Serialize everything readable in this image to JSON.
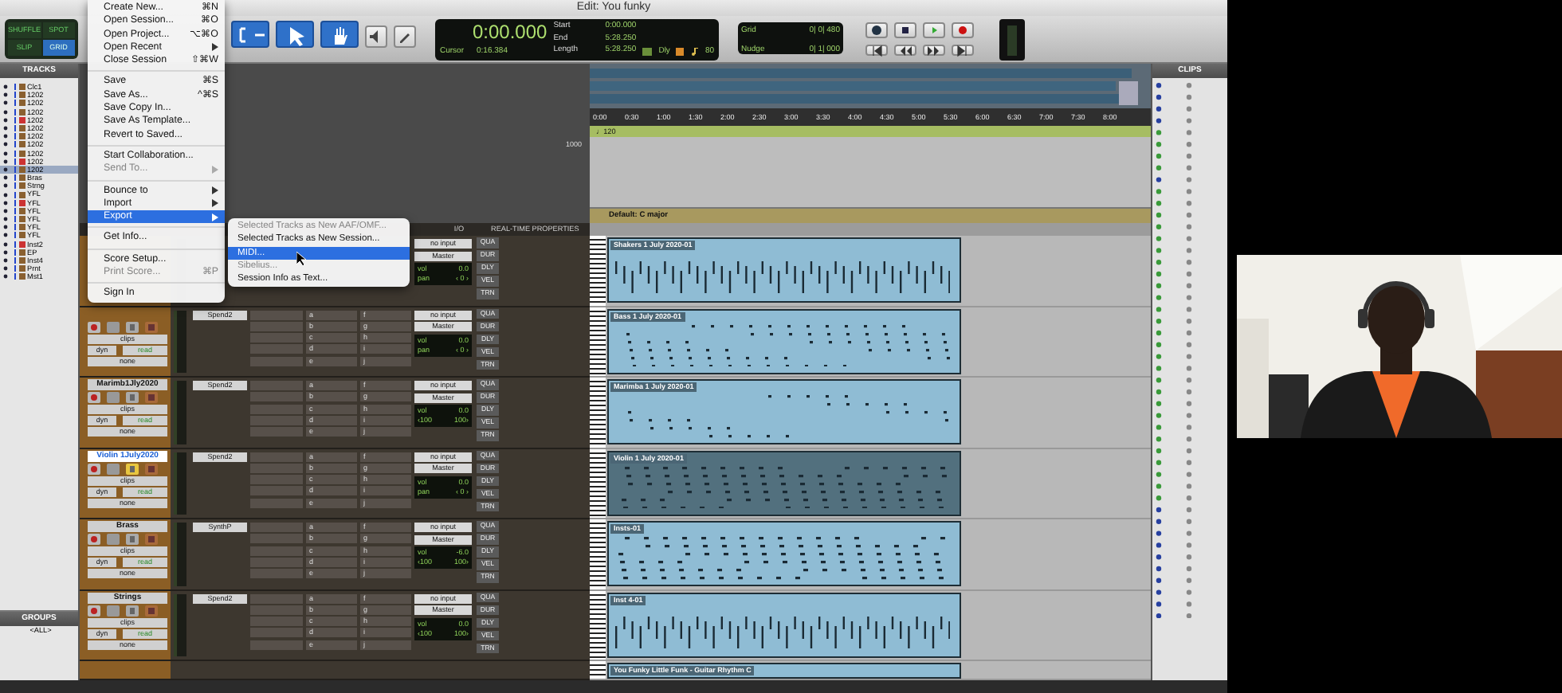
{
  "window": {
    "title": "Edit: You funky"
  },
  "modes": [
    {
      "label": "SHUFFLE",
      "selected": false
    },
    {
      "label": "SPOT",
      "selected": false
    },
    {
      "label": "SLIP",
      "selected": false
    },
    {
      "label": "GRID",
      "selected": true
    }
  ],
  "counter": {
    "main": "0:00.000",
    "start_label": "Start",
    "start": "0:00.000",
    "end_label": "End",
    "end": "5:28.250",
    "length_label": "Length",
    "length": "5:28.250",
    "cursor_label": "Cursor",
    "cursor": "0:16.384",
    "delay": "Dly",
    "value": "80"
  },
  "grid": {
    "label": "Grid",
    "value": "0| 0| 480"
  },
  "nudge": {
    "label": "Nudge",
    "value": "0| 1| 000"
  },
  "tracks_panel": {
    "title": "TRACKS",
    "items": [
      {
        "name": "Clc1",
        "selected": false
      },
      {
        "name": "1202",
        "selected": false
      },
      {
        "name": "1202",
        "selected": false
      },
      {
        "name": "1202",
        "selected": false
      },
      {
        "name": "1202",
        "selected": false
      },
      {
        "name": "1202",
        "selected": false
      },
      {
        "name": "1202",
        "selected": false
      },
      {
        "name": "1202",
        "selected": false
      },
      {
        "name": "1202",
        "selected": false
      },
      {
        "name": "1202",
        "selected": false
      },
      {
        "name": "1202",
        "selected": true
      },
      {
        "name": "Bras",
        "selected": false
      },
      {
        "name": "Strng",
        "selected": false
      },
      {
        "name": "YFL",
        "selected": false
      },
      {
        "name": "YFL",
        "selected": false
      },
      {
        "name": "YFL",
        "selected": false
      },
      {
        "name": "YFL",
        "selected": false
      },
      {
        "name": "YFL",
        "selected": false
      },
      {
        "name": "YFL",
        "selected": false
      },
      {
        "name": "Inst2",
        "selected": false
      },
      {
        "name": "EP",
        "selected": false
      },
      {
        "name": "Inst4",
        "selected": false
      },
      {
        "name": "Prnt",
        "selected": false
      },
      {
        "name": "Mst1",
        "selected": false
      }
    ]
  },
  "groups_panel": {
    "title": "GROUPS",
    "items": [
      "<ALL>"
    ]
  },
  "file_menu": {
    "items": [
      {
        "kind": "item",
        "label": "Create New...",
        "shortcut": "⌘N",
        "disabled": false,
        "submenu": false,
        "selected": false
      },
      {
        "kind": "item",
        "label": "Open Session...",
        "shortcut": "⌘O",
        "disabled": false,
        "submenu": false,
        "selected": false
      },
      {
        "kind": "item",
        "label": "Open Project...",
        "shortcut": "⌥⌘O",
        "disabled": false,
        "submenu": false,
        "selected": false
      },
      {
        "kind": "item",
        "label": "Open Recent",
        "disabled": false,
        "submenu": true,
        "selected": false
      },
      {
        "kind": "item",
        "label": "Close Session",
        "shortcut": "⇧⌘W",
        "disabled": false,
        "submenu": false,
        "selected": false
      },
      {
        "kind": "separator"
      },
      {
        "kind": "item",
        "label": "Save",
        "shortcut": "⌘S",
        "disabled": false,
        "submenu": false,
        "selected": false
      },
      {
        "kind": "item",
        "label": "Save As...",
        "shortcut": "^⌘S",
        "disabled": false,
        "submenu": false,
        "selected": false
      },
      {
        "kind": "item",
        "label": "Save Copy In...",
        "disabled": false,
        "submenu": false,
        "selected": false
      },
      {
        "kind": "item",
        "label": "Save As Template...",
        "disabled": false,
        "submenu": false,
        "selected": false
      },
      {
        "kind": "item",
        "label": "Revert to Saved...",
        "disabled": false,
        "submenu": false,
        "selected": false
      },
      {
        "kind": "separator"
      },
      {
        "kind": "item",
        "label": "Start Collaboration...",
        "disabled": false,
        "submenu": false,
        "selected": false
      },
      {
        "kind": "item",
        "label": "Send To...",
        "disabled": true,
        "submenu": true,
        "selected": false
      },
      {
        "kind": "separator"
      },
      {
        "kind": "item",
        "label": "Bounce to",
        "disabled": false,
        "submenu": true,
        "selected": false
      },
      {
        "kind": "item",
        "label": "Import",
        "disabled": false,
        "submenu": true,
        "selected": false
      },
      {
        "kind": "item",
        "label": "Export",
        "disabled": false,
        "submenu": true,
        "selected": true
      },
      {
        "kind": "separator"
      },
      {
        "kind": "item",
        "label": "Get Info...",
        "disabled": false,
        "submenu": false,
        "selected": false
      },
      {
        "kind": "separator"
      },
      {
        "kind": "item",
        "label": "Score Setup...",
        "disabled": false,
        "submenu": false,
        "selected": false
      },
      {
        "kind": "item",
        "label": "Print Score...",
        "shortcut": "⌘P",
        "disabled": true,
        "submenu": false,
        "selected": false
      },
      {
        "kind": "separator"
      },
      {
        "kind": "item",
        "label": "Sign In",
        "disabled": false,
        "submenu": false,
        "selected": false
      }
    ]
  },
  "export_submenu": {
    "items": [
      {
        "label": "Selected Tracks as New AAF/OMF...",
        "disabled": true,
        "selected": false
      },
      {
        "label": "Selected Tracks as New Session...",
        "disabled": false,
        "selected": false
      },
      {
        "label": "MIDI...",
        "disabled": false,
        "selected": true
      },
      {
        "label": "Sibelius...",
        "disabled": true,
        "selected": false
      },
      {
        "label": "Session Info as Text...",
        "disabled": false,
        "selected": false
      }
    ]
  },
  "conductor": {
    "scale": "1000",
    "tempo": "♩120",
    "key": "Default: C major"
  },
  "ruler": [
    "0:00",
    "0:30",
    "1:00",
    "1:30",
    "2:00",
    "2:30",
    "3:00",
    "3:30",
    "4:00",
    "4:30",
    "5:00",
    "5:30",
    "6:00",
    "6:30",
    "7:00",
    "7:30",
    "8:00"
  ],
  "mix": {
    "io_header": "I/O",
    "rtp_header": "REAL-TIME PROPERTIES",
    "strips": [
      {
        "input": "no input",
        "output": "Master",
        "vol_label": "vol",
        "vol": "0.0",
        "pan": [
          "pan",
          "‹ 0 ›"
        ],
        "rtp": [
          "QUA",
          "DUR",
          "DLY",
          "VEL",
          "TRN"
        ]
      },
      {
        "solo": false,
        "view": "clips",
        "dyn": "dyn",
        "automation": "read",
        "group": "none",
        "insert": "Spend2",
        "sends": [
          "a",
          "b",
          "c",
          "d",
          "e",
          "f",
          "g",
          "h",
          "i",
          "j"
        ],
        "input": "no input",
        "output": "Master",
        "vol_label": "vol",
        "vol": "0.0",
        "pan": [
          "pan",
          "‹ 0 ›"
        ],
        "rtp": [
          "QUA",
          "DUR",
          "DLY",
          "VEL",
          "TRN"
        ]
      },
      {
        "name": "Marimb1Jly2020",
        "selected": false,
        "solo": false,
        "view": "clips",
        "dyn": "dyn",
        "automation": "read",
        "group": "none",
        "insert": "Spend2",
        "sends": [
          "a",
          "b",
          "c",
          "d",
          "e",
          "f",
          "g",
          "h",
          "i",
          "j"
        ],
        "input": "no input",
        "output": "Master",
        "vol_label": "vol",
        "vol": "0.0",
        "pan": [
          "‹100",
          "100›"
        ],
        "rtp": [
          "QUA",
          "DUR",
          "DLY",
          "VEL",
          "TRN"
        ]
      },
      {
        "name": "Violin 1July2020",
        "selected": true,
        "solo": true,
        "view": "clips",
        "dyn": "dyn",
        "automation": "read",
        "group": "none",
        "insert": "Spend2",
        "sends": [
          "a",
          "b",
          "c",
          "d",
          "e",
          "f",
          "g",
          "h",
          "i",
          "j"
        ],
        "input": "no input",
        "output": "Master",
        "vol_label": "vol",
        "vol": "0.0",
        "pan": [
          "pan",
          "‹ 0 ›"
        ],
        "rtp": [
          "QUA",
          "DUR",
          "DLY",
          "VEL",
          "TRN"
        ]
      },
      {
        "name": "Brass",
        "selected": false,
        "solo": false,
        "view": "clips",
        "dyn": "dyn",
        "automation": "read",
        "group": "none",
        "insert": "SynthP",
        "sends": [
          "a",
          "b",
          "c",
          "d",
          "e",
          "f",
          "g",
          "h",
          "i",
          "j"
        ],
        "input": "no input",
        "output": "Master",
        "vol_label": "vol",
        "vol": "-6.0",
        "pan": [
          "‹100",
          "100›"
        ],
        "rtp": [
          "QUA",
          "DUR",
          "DLY",
          "VEL",
          "TRN"
        ]
      },
      {
        "name": "Strings",
        "selected": false,
        "solo": false,
        "view": "clips",
        "dyn": "dyn",
        "automation": "read",
        "group": "none",
        "insert": "Spend2",
        "sends": [
          "a",
          "b",
          "c",
          "d",
          "e",
          "f",
          "g",
          "h",
          "i",
          "j"
        ],
        "input": "no input",
        "output": "Master",
        "vol_label": "vol",
        "vol": "0.0",
        "pan": [
          "‹100",
          "100›"
        ],
        "rtp": [
          "QUA",
          "DUR",
          "DLY",
          "VEL",
          "TRN"
        ]
      }
    ]
  },
  "clips": [
    {
      "name": "Shakers 1 July 2020-01",
      "kind": "hits",
      "selected": false
    },
    {
      "name": "Bass 1 July 2020-01",
      "kind": "notes",
      "selected": false
    },
    {
      "name": "Marimba 1 July 2020-01",
      "kind": "sparse",
      "selected": false
    },
    {
      "name": "Violin 1 July 2020-01",
      "kind": "chords",
      "selected": true
    },
    {
      "name": "Insts-01",
      "kind": "chords",
      "selected": false
    },
    {
      "name": "Inst 4-01",
      "kind": "hits",
      "selected": false
    },
    {
      "name": "You Funky Little Funk - Guitar Rhythm C",
      "kind": "strip",
      "selected": false
    }
  ],
  "clips_panel": {
    "title": "CLIPS"
  }
}
